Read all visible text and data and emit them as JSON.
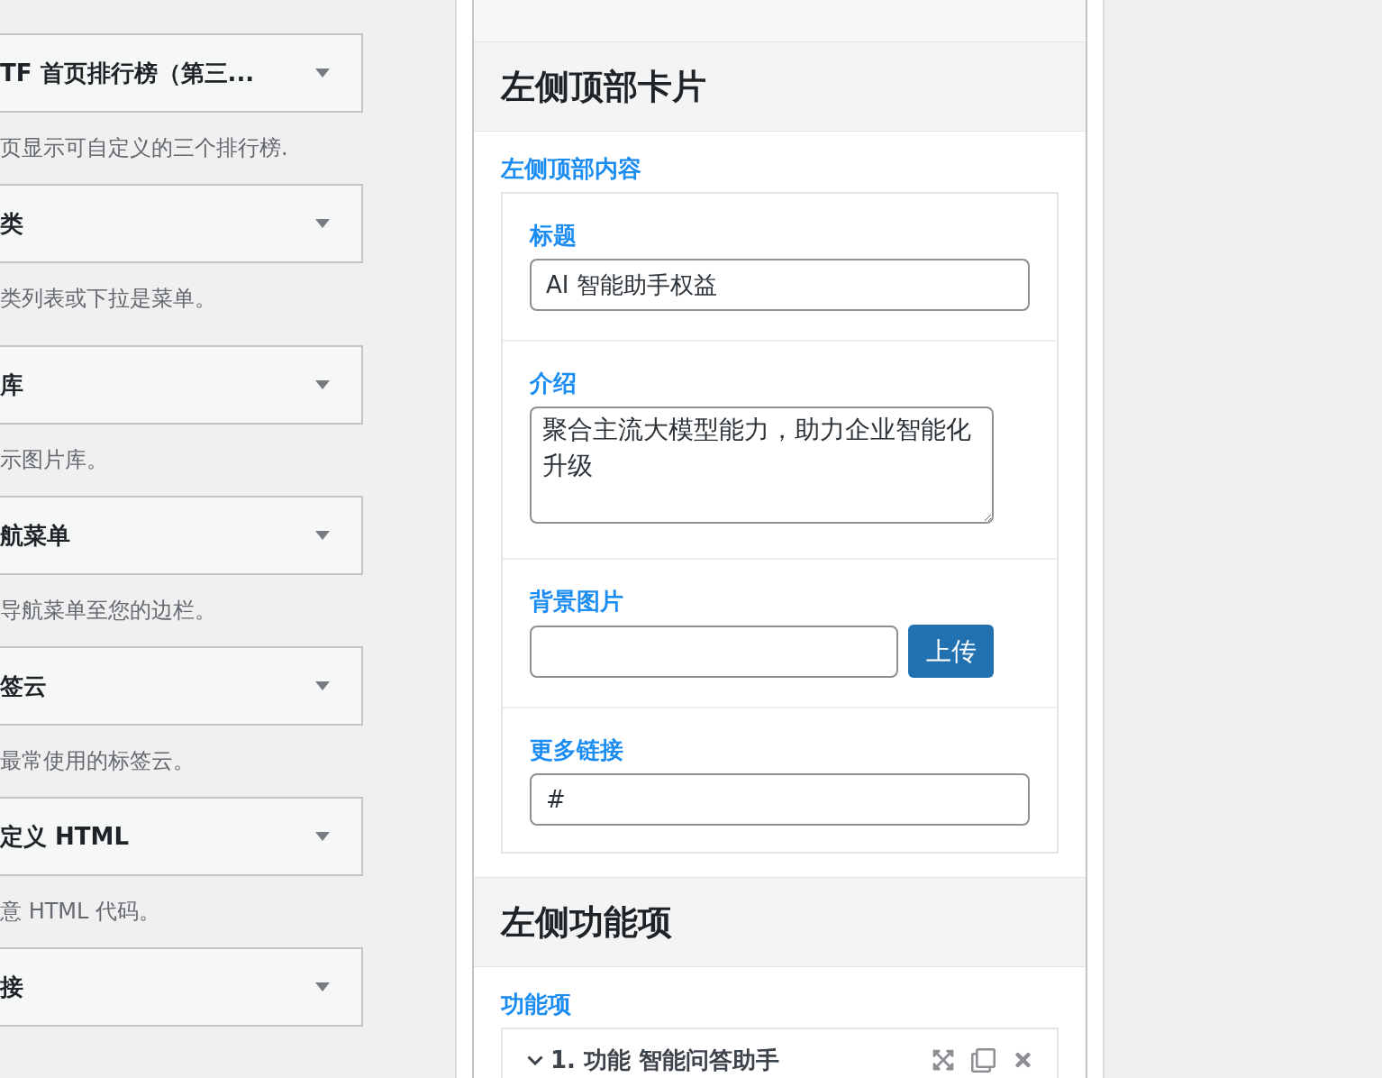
{
  "widgets": [
    {
      "title": "TF 首页排行榜（第三...",
      "description": "页显示可自定义的三个排行榜."
    },
    {
      "title": "类",
      "description": "类列表或下拉是菜单。"
    },
    {
      "title": "库",
      "description": "示图片库。"
    },
    {
      "title": "航菜单",
      "description": "导航菜单至您的边栏。"
    },
    {
      "title": "签云",
      "description": "最常使用的标签云。"
    },
    {
      "title": "定义 HTML",
      "description": "意 HTML 代码。"
    },
    {
      "title": "接"
    }
  ],
  "panel": {
    "sections": [
      {
        "heading": "左侧顶部卡片",
        "group_label": "左侧顶部内容",
        "fields": [
          {
            "kind": "text",
            "label": "标题",
            "value": "AI 智能助手权益"
          },
          {
            "kind": "textarea",
            "label": "介绍",
            "value": "聚合主流大模型能力，助力企业智能化升级"
          },
          {
            "kind": "upload",
            "label": "背景图片",
            "button": "上传"
          },
          {
            "kind": "text",
            "label": "更多链接",
            "value": "#"
          }
        ]
      },
      {
        "heading": "左侧功能项",
        "group_label": "功能项",
        "items": [
          {
            "title": "1. 功能 智能问答助手",
            "expanded": true
          }
        ]
      }
    ]
  }
}
